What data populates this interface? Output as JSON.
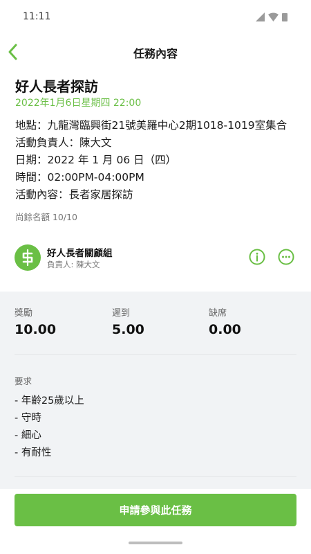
{
  "status_bar": {
    "time": "11:11"
  },
  "app_bar": {
    "title": "任務內容"
  },
  "task": {
    "title": "好人長者探訪",
    "datetime": "2022年1月6日星期四 22:00",
    "details": [
      "地點：九龍灣臨興街21號美羅中心2期1018-1019室集合",
      "活動負責人：陳大文",
      "日期：2022 年 1 月 06 日（四）",
      "時間：02:00PM-04:00PM",
      "活動內容：長者家居探訪"
    ],
    "quota": "尚餘名額 10/10"
  },
  "group": {
    "name": "好人長者關顧組",
    "leader": "負責人: 陳大文"
  },
  "stats": [
    {
      "label": "獎勵",
      "value": "10.00"
    },
    {
      "label": "遲到",
      "value": "5.00"
    },
    {
      "label": "缺席",
      "value": "0.00"
    }
  ],
  "requirements": {
    "label": "要求",
    "items": [
      "- 年齡25歲以上",
      "- 守時",
      "- 細心",
      "- 有耐性"
    ]
  },
  "actions": {
    "apply_label": "申請參與此任務"
  },
  "colors": {
    "accent": "#6abf45",
    "section_bg": "#f1f3f5"
  },
  "icons": {
    "back": "chevron-left-icon",
    "info": "info-icon",
    "more": "more-horizontal-icon",
    "group_logo": "dollar-icon"
  }
}
